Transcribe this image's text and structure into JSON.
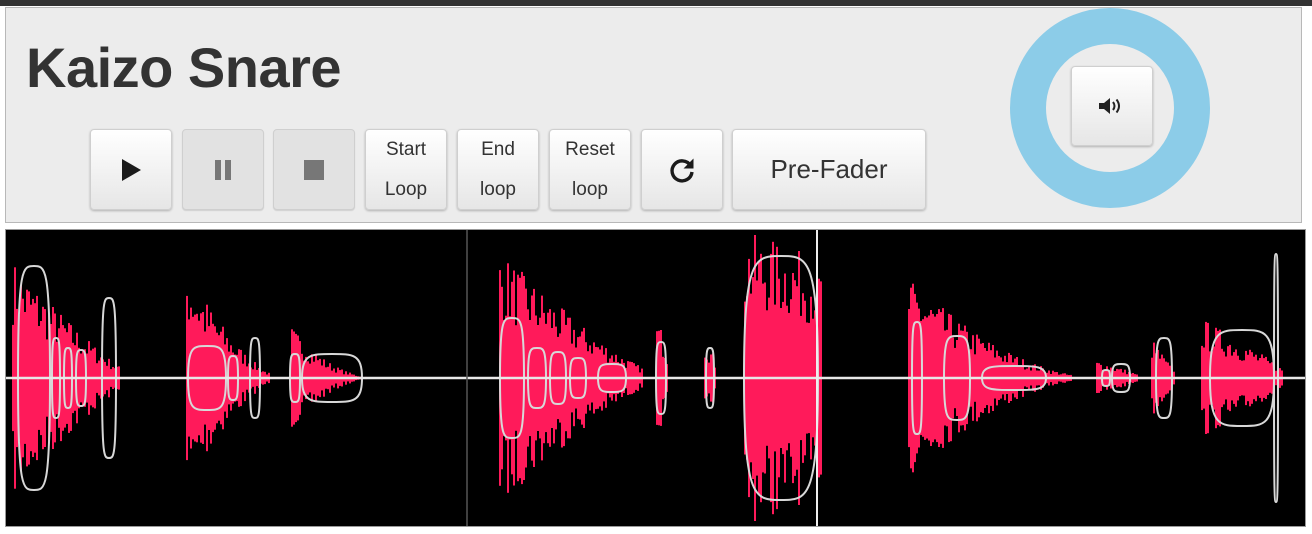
{
  "title": "Kaizo Snare",
  "controls": {
    "play_icon": "play-icon",
    "pause_icon": "pause-icon",
    "stop_icon": "stop-icon",
    "start_loop": [
      "Start",
      "Loop"
    ],
    "end_loop": [
      "End",
      "loop"
    ],
    "reset_loop": [
      "Reset",
      "loop"
    ],
    "repeat_icon": "refresh-icon",
    "pre_fader": "Pre-Fader"
  },
  "volume": {
    "icon": "volume-icon"
  },
  "waveform": {
    "background": "#000000",
    "wave_color": "#ff1a5a",
    "envelope_color": "#d8d8d8",
    "ring_color": "#8ccce8"
  }
}
